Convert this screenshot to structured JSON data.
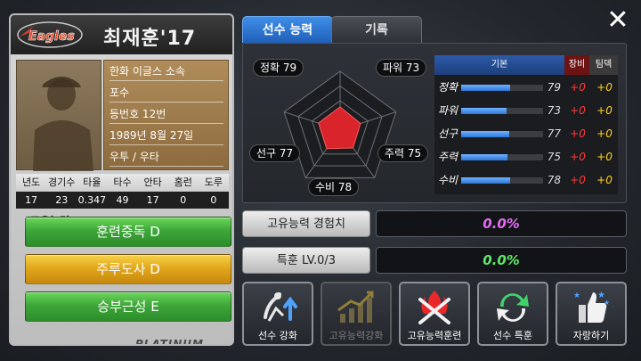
{
  "player": {
    "name": "최재훈'17",
    "team_logo_text": "Eagles",
    "info": [
      "한화 이글스 소속",
      "포수",
      "등번호 12번",
      "1989년 8월 27일",
      "우투 / 우타"
    ],
    "grade": "PLATINUM"
  },
  "record_summary": {
    "headers": [
      "년도",
      "경기수",
      "타율",
      "타수",
      "안타",
      "홈런",
      "도루"
    ],
    "values": [
      "17",
      "23",
      "0.347",
      "49",
      "17",
      "0",
      "0"
    ]
  },
  "unique_abilities": {
    "label": "고유능력",
    "items": [
      {
        "label": "훈련중독 D",
        "color": "#3ea73a"
      },
      {
        "label": "주루도사 D",
        "color": "#e2a81c"
      },
      {
        "label": "승부근성 E",
        "color": "#3ea73a"
      }
    ]
  },
  "tabs": [
    {
      "label": "선수 능력",
      "active": true
    },
    {
      "label": "기록",
      "active": false
    }
  ],
  "close_icon": "close-icon",
  "radar": {
    "labels": [
      {
        "key": "contact",
        "text": "정확 79"
      },
      {
        "key": "power",
        "text": "파워 73"
      },
      {
        "key": "speed",
        "text": "주력 75"
      },
      {
        "key": "defense",
        "text": "수비 78"
      },
      {
        "key": "eye",
        "text": "선구 77"
      }
    ],
    "values": [
      79,
      73,
      75,
      78,
      77
    ],
    "max": 100,
    "fill_color": "#d9242b"
  },
  "stat_table": {
    "headers": {
      "base": "기본",
      "equip": "장비",
      "perk": "팀덱"
    },
    "rows": [
      {
        "name": "정확",
        "value": "79",
        "equip": "+0",
        "perk": "+0",
        "level": 0.79
      },
      {
        "name": "파워",
        "value": "73",
        "equip": "+0",
        "perk": "+0",
        "level": 0.73
      },
      {
        "name": "선구",
        "value": "77",
        "equip": "+0",
        "perk": "+0",
        "level": 0.77
      },
      {
        "name": "주력",
        "value": "75",
        "equip": "+0",
        "perk": "+0",
        "level": 0.75
      },
      {
        "name": "수비",
        "value": "78",
        "equip": "+0",
        "perk": "+0",
        "level": 0.78
      }
    ]
  },
  "exp": [
    {
      "label": "고유능력 경험치",
      "value": "0.0%",
      "color": "#e36cf5"
    },
    {
      "label": "특훈 LV.0/3",
      "value": "0.0%",
      "color": "#5fe86a"
    }
  ],
  "actions": [
    {
      "label": "선수 강화",
      "icon": "batter-upgrade-icon",
      "enabled": true
    },
    {
      "label": "고유능력강화",
      "icon": "growth-chart-icon",
      "enabled": false
    },
    {
      "label": "고유능력훈련",
      "icon": "flaming-bats-icon",
      "enabled": true
    },
    {
      "label": "선수 특훈",
      "icon": "recycle-arrows-icon",
      "enabled": true
    },
    {
      "label": "자랑하기",
      "icon": "thumbs-up-icon",
      "enabled": true
    }
  ]
}
